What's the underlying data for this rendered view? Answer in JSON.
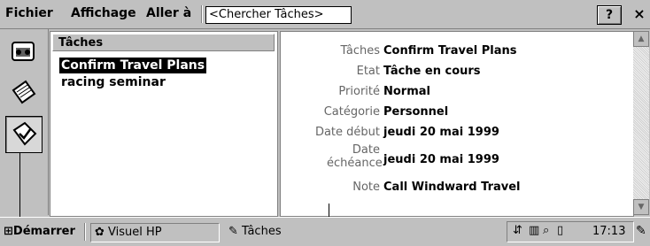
{
  "menubar": {
    "items": [
      "Fichier",
      "Affichage",
      "Aller à"
    ],
    "search_placeholder": "<Chercher Tâches>",
    "help_label": "?",
    "close_label": "×"
  },
  "left_icons": [
    "inbox-icon",
    "calendar-icon",
    "tasks-icon"
  ],
  "task_list": {
    "header": "Tâches",
    "items": [
      {
        "label": "Confirm Travel Plans",
        "selected": true
      },
      {
        "label": "racing seminar",
        "selected": false
      }
    ]
  },
  "detail": {
    "fields": [
      {
        "label": "Tâches",
        "value": "Confirm Travel Plans"
      },
      {
        "label": "Etat",
        "value": "Tâche en cours"
      },
      {
        "label": "Priorité",
        "value": "Normal"
      },
      {
        "label": "Catégorie",
        "value": "Personnel"
      },
      {
        "label": "Date début",
        "value": "jeudi 20 mai 1999"
      },
      {
        "label": "Date échéance",
        "value": "jeudi 20 mai 1999"
      },
      {
        "label": "Note",
        "value": "Call Windward Travel"
      }
    ]
  },
  "taskbar": {
    "start_label": "Démarrer",
    "apps": [
      "Visuel HP",
      "Tâches"
    ],
    "time": "17:13"
  }
}
